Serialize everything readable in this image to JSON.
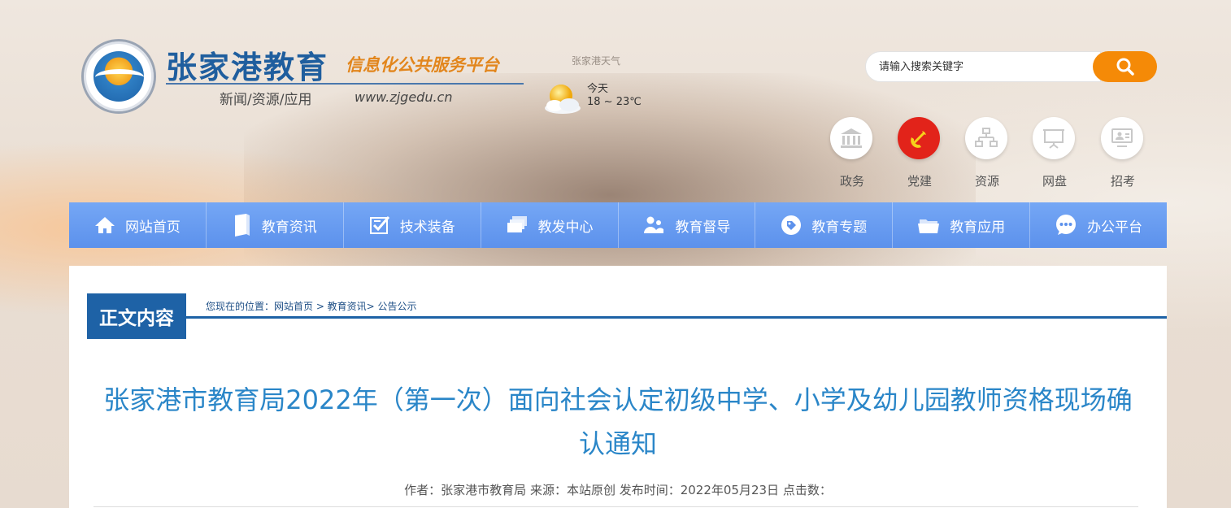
{
  "header": {
    "logo_title": "张家港教育",
    "logo_subtitle": "信息化公共服务平台",
    "logo_tagline": "新闻/资源/应用",
    "logo_url": "www.zjgedu.cn"
  },
  "weather": {
    "city": "张家港天气",
    "today": "今天",
    "temp": "18 ~ 23℃",
    "icon": "sun-cloud-icon"
  },
  "search": {
    "placeholder": "请输入搜索关键字",
    "button_icon": "search-icon",
    "accent": "#f58a07"
  },
  "quick_links": [
    {
      "label": "政务",
      "icon": "government-icon"
    },
    {
      "label": "党建",
      "icon": "party-emblem-icon"
    },
    {
      "label": "资源",
      "icon": "sitemap-icon"
    },
    {
      "label": "网盘",
      "icon": "presentation-icon"
    },
    {
      "label": "招考",
      "icon": "monitor-user-icon"
    }
  ],
  "nav": {
    "items": [
      {
        "label": "网站首页",
        "icon": "home-icon"
      },
      {
        "label": "教育资讯",
        "icon": "book-icon"
      },
      {
        "label": "技术装备",
        "icon": "checklist-icon"
      },
      {
        "label": "教发中心",
        "icon": "stack-icon"
      },
      {
        "label": "教育督导",
        "icon": "users-icon"
      },
      {
        "label": "教育专题",
        "icon": "tag-icon"
      },
      {
        "label": "教育应用",
        "icon": "folder-icon"
      },
      {
        "label": "办公平台",
        "icon": "chat-icon"
      }
    ],
    "color": "#5c91ec"
  },
  "content": {
    "section_label": "正文内容",
    "breadcrumb": "您现在的位置：网站首页 > 教育资讯> 公告公示",
    "title": "张家港市教育局2022年（第一次）面向社会认定初级中学、小学及幼儿园教师资格现场确认通知",
    "meta": "作者：张家港市教育局 来源：本站原创 发布时间：2022年05月23日 点击数：",
    "accent": "#1e62a6",
    "title_color": "#2a86c8"
  }
}
